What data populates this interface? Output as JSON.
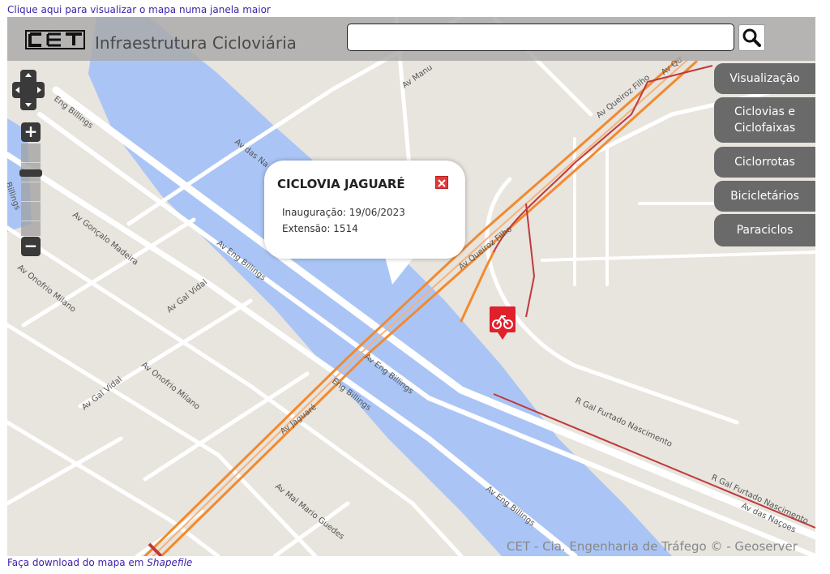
{
  "top_link": "Clique aqui para visualizar o mapa numa janela maior",
  "bottom_link_prefix": "Faça download do mapa em ",
  "bottom_link_italic": "Shapefile",
  "header": {
    "logo_text": "CET",
    "title": "Infraestrutura Cicloviária",
    "search_value": "",
    "search_icon": "search-icon"
  },
  "map_controls": {
    "pan_icon": "pan-arrows-icon",
    "zoom_in_label": "+",
    "zoom_out_label": "−"
  },
  "layer_panel": [
    {
      "label": "Visualização"
    },
    {
      "label": "Ciclovias e Ciclofaixas"
    },
    {
      "label": "Ciclorrotas"
    },
    {
      "label": "Bicicletários"
    },
    {
      "label": "Paraciclos"
    }
  ],
  "popup": {
    "title": "CICLOVIA JAGUARÉ",
    "inauguration": "Inauguração: 19/06/2023",
    "length": "Extensão: 1514",
    "close_icon": "close-icon"
  },
  "map_labels": {
    "eng_billings": "Av Eng Billings",
    "eng_billings_short": "Eng Billings",
    "gonzalo": "Av Gonçalo Madeira",
    "onofrio_1": "Av Onofrio Milano",
    "onofrio_2": "Av Onofrio Milano",
    "gal_vidal_1": "Av Gal Vidal",
    "gal_vidal_2": "Av Gal Vidal",
    "das_nacoes": "Av das Na",
    "manuel": "Av Manu",
    "queiroz_1": "Av Queiroz Filho",
    "queiroz_2": "Av Queiroz Filho",
    "queiroz_3": "Av Qu",
    "jaguare": "Av Jaguaré",
    "eng_billings_2": "Av Eng Billings",
    "eng_billings_3": "Av Eng Billings",
    "eng_billings_4": "Eng Billings",
    "furtado_1": "R Gal Furtado Nascimento",
    "furtado_2": "R Gal Furtado Nascimento",
    "das_nacoes_2": "Av das Naçoes",
    "mal_mario": "Av Mal Mario Guedes",
    "eng_billings_5": "Av Eng Billings",
    "edge_left": "Billings"
  },
  "attribution": "CET - Cia. Engenharia de Tráfego © - Geoserver",
  "colors": {
    "water": "#aac5f5",
    "land": "#e8e4de",
    "road": "#ffffff",
    "bikeway_orange": "#f28a2e",
    "bikeway_red": "#c0393b",
    "marker_red": "#e0202a"
  }
}
